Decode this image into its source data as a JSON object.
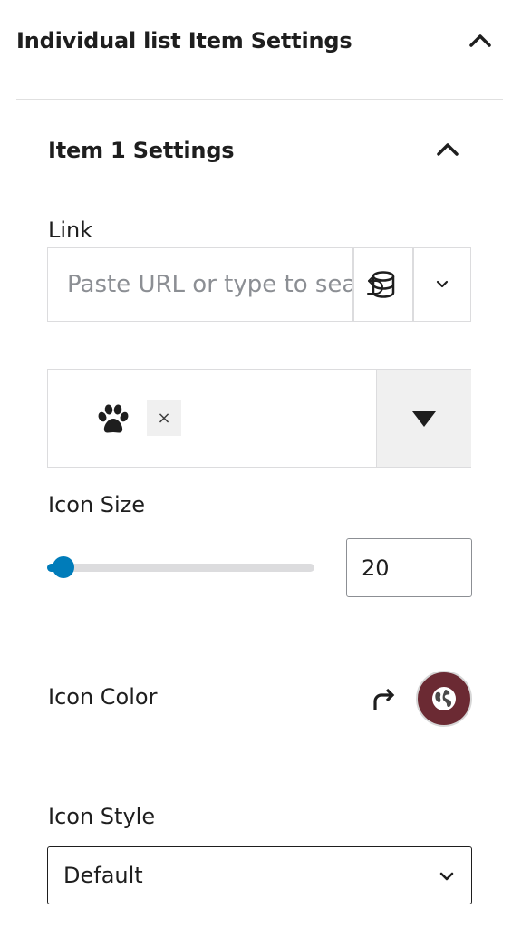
{
  "panel": {
    "title": "Individual list Item Settings",
    "collapse_icon": "chevron-up-icon"
  },
  "item": {
    "title": "Item 1 Settings",
    "collapse_icon": "chevron-up-icon"
  },
  "link": {
    "label": "Link",
    "placeholder": "Paste URL or type to search",
    "submit_icon": "enter-icon",
    "dynamic_icon": "database-icon",
    "dropdown_icon": "chevron-down-icon"
  },
  "icon_picker": {
    "selected_icon": "paw-icon",
    "remove_label": "×",
    "toggle_icon": "caret-down-icon"
  },
  "icon_size": {
    "label": "Icon Size",
    "value": "20",
    "slider_fraction": 0.06,
    "accent": "#007cba"
  },
  "icon_color": {
    "label": "Icon Color",
    "reset_icon": "redo-arrow-icon",
    "swatch_color": "#6b2a33",
    "swatch_icon": "globe-icon"
  },
  "icon_style": {
    "label": "Icon Style",
    "value": "Default",
    "options": [
      "Default"
    ]
  }
}
